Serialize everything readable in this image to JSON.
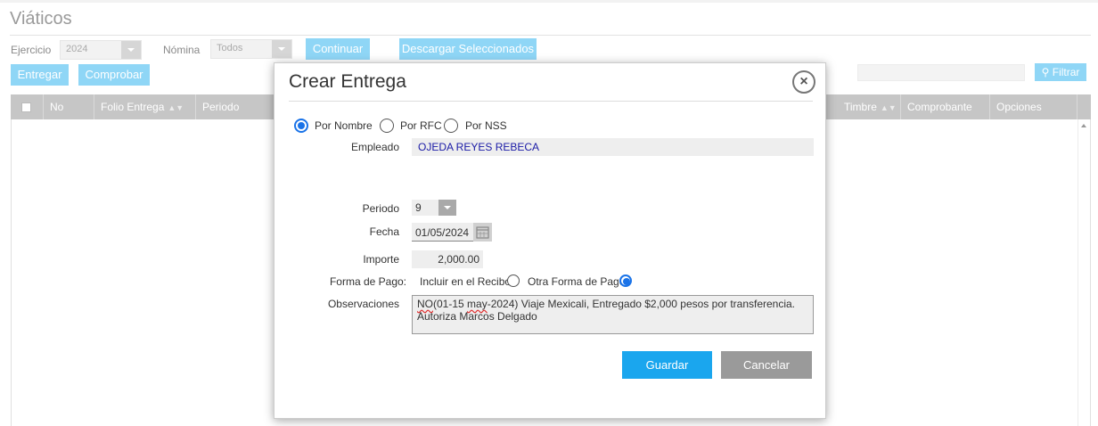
{
  "page": {
    "title": "Viáticos"
  },
  "filters": {
    "ejercicio_label": "Ejercicio",
    "ejercicio_value": "2024",
    "nomina_label": "Nómina",
    "nomina_value": "Todos",
    "continuar_label": "Continuar",
    "descargar_label": "Descargar Seleccionados"
  },
  "actions": {
    "entregar_label": "Entregar",
    "comprobar_label": "Comprobar"
  },
  "search": {
    "placeholder": "",
    "filter_label": "Filtrar"
  },
  "table": {
    "sort_glyph": "▲▼",
    "columns": {
      "no": "No",
      "folio": "Folio Entrega",
      "periodo": "Periodo",
      "timbre": "Timbre",
      "comprobante": "Comprobante",
      "opciones": "Opciones"
    }
  },
  "modal": {
    "title": "Crear Entrega",
    "close_glyph": "×",
    "search_by": {
      "nombre": "Por Nombre",
      "rfc": "Por RFC",
      "nss": "Por NSS",
      "selected": "Por Nombre"
    },
    "empleado_label": "Empleado",
    "empleado_value": "OJEDA REYES REBECA",
    "periodo_label": "Periodo",
    "periodo_value": "9",
    "fecha_label": "Fecha",
    "fecha_value": "01/05/2024",
    "importe_label": "Importe",
    "importe_value": "2,000.00",
    "forma_pago_label": "Forma de Pago:",
    "forma_pago_recibo": "Incluir en el Recibo",
    "forma_pago_otra": "Otra Forma de Pago",
    "forma_pago_selected": "Otra Forma de Pago",
    "observaciones_label": "Observaciones",
    "observaciones_word1": "NO",
    "observaciones_word2": "(01-15 ",
    "observaciones_word3": "may",
    "observaciones_rest": "-2024)  Viaje Mexicali, Entregado $2,000 pesos por transferencia.",
    "observaciones_line2": "Autoriza Marcos Delgado",
    "guardar_label": "Guardar",
    "cancelar_label": "Cancelar"
  },
  "colors": {
    "accent": "#1aa6ee",
    "light_button": "#8fd6f6",
    "header": "#c6c6c6",
    "cancel": "#9a9a9a"
  }
}
